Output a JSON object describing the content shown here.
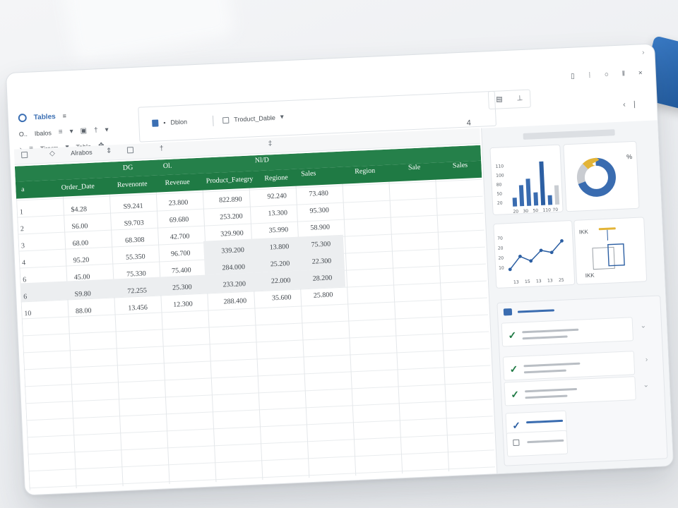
{
  "app": {
    "title": "Tables",
    "title_suffix": "≡"
  },
  "ribbon": {
    "row1": [
      "O..",
      "Ibalos",
      "≡"
    ],
    "row2": [
      "Tirarm",
      "Table"
    ],
    "row3": [
      "Alrabos"
    ]
  },
  "tabs": [
    {
      "label": "Dblon",
      "prefix": "•"
    },
    {
      "label": "Troduct_Dable"
    }
  ],
  "sheet_index": "4",
  "headers_top": [
    "DG",
    "Ol.",
    "Nl/D",
    "Sales",
    "Region",
    "Sale",
    "Sales"
  ],
  "headers": [
    "Order_Date",
    "Revenonte",
    "Revenue",
    "Product_Fategry",
    "Regione"
  ],
  "rows": [
    {
      "n": "1",
      "cells": [
        "$4.28",
        "S9.241",
        "23.800",
        "822.890",
        "92.240",
        "73.480"
      ]
    },
    {
      "n": "2",
      "cells": [
        "S6.00",
        "S9.703",
        "69.680",
        "253.200",
        "13.300",
        "95.300"
      ]
    },
    {
      "n": "3",
      "cells": [
        "68.00",
        "68.308",
        "42.700",
        "329.900",
        "35.990",
        "58.900"
      ]
    },
    {
      "n": "4",
      "cells": [
        "95.20",
        "55.350",
        "96.700",
        "339.200",
        "13.800",
        "75.300"
      ]
    },
    {
      "n": "6",
      "cells": [
        "45.00",
        "75.330",
        "75.400",
        "284.000",
        "25.200",
        "22.300"
      ]
    },
    {
      "n": "6",
      "cells": [
        "S9.80",
        "72.255",
        "25.300",
        "233.200",
        "22.000",
        "28.200"
      ]
    },
    {
      "n": "10",
      "cells": [
        "88.00",
        "13.456",
        "12.300",
        "288.400",
        "35.600",
        "25.800"
      ]
    }
  ],
  "bar_chart": {
    "y_ticks": [
      "110",
      "100",
      "80",
      "50",
      "20"
    ],
    "x_ticks": [
      "20",
      "30",
      "50",
      "110",
      "70"
    ],
    "values": [
      20,
      48,
      62,
      30,
      100,
      22,
      44
    ],
    "colors": [
      "#3a6cb0",
      "#3a6cb0",
      "#3a6cb0",
      "#3a6cb0",
      "#2c5fa3",
      "#3a6cb0",
      "#c9cdd2"
    ]
  },
  "donut": {
    "label": "%",
    "slices": [
      {
        "value": 70,
        "color": "#3a6cb0"
      },
      {
        "value": 18,
        "color": "#c9ccd1"
      },
      {
        "value": 12,
        "color": "#e3b437"
      }
    ]
  },
  "line_chart": {
    "y_ticks": [
      "70",
      "20",
      "20",
      "10"
    ],
    "x_ticks": [
      "13",
      "15",
      "13",
      "13",
      "25"
    ],
    "values": [
      10,
      35,
      25,
      45,
      40,
      62
    ]
  },
  "mini_chart": {
    "label_top": "IKK",
    "label_bottom": "IKK"
  },
  "tasks": [
    {
      "icon": "check",
      "accent": "green"
    },
    {
      "icon": "check",
      "accent": "green"
    },
    {
      "icon": "check",
      "accent": "green"
    },
    {
      "icon": "check",
      "accent": "blue"
    },
    {
      "icon": "box",
      "accent": "none"
    }
  ],
  "colors": {
    "accent_green": "#1f7a44",
    "accent_blue": "#3a6cb0",
    "gold": "#e3b437"
  }
}
